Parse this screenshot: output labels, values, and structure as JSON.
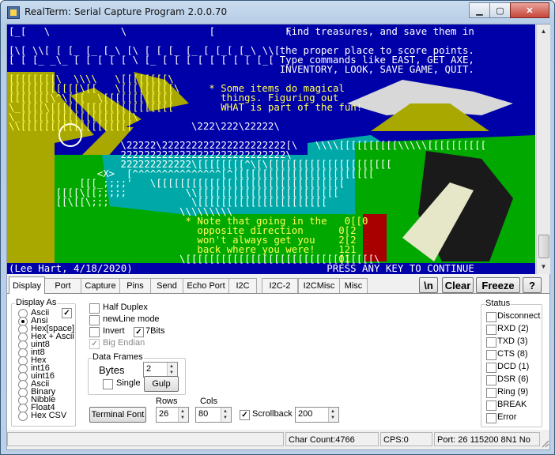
{
  "window": {
    "title": "RealTerm: Serial Capture Program 2.0.0.70"
  },
  "terminal": {
    "art": [
      {
        "t": "[_[   \\            \\              [            \\ ",
        "c": "w",
        "r": 0
      },
      {
        "t": "Find treasures, and save them in",
        "c": "w",
        "r": 0,
        "col": 47
      },
      {
        "t": "[\\[ \\\\[ [ [_ [_ [_\\ [\\ [ [ [_ [_ [ [_[ [_\\ \\\\[",
        "c": "w",
        "r": 2
      },
      {
        "t": "the proper place to score points.",
        "c": "w",
        "r": 2,
        "col": 46
      },
      {
        "t": "[ [ [_ _\\_ [ [ [ [ [ \\ [_ [ [ [ [ [ [ [ [ [_[",
        "c": "w",
        "r": 3
      },
      {
        "t": "Type commands like EAST, GET AXE,",
        "c": "w",
        "r": 3,
        "col": 46
      },
      {
        "t": "INVENTORY, LOOK, SAVE GAME, QUIT.",
        "c": "w",
        "r": 4,
        "col": 46
      },
      {
        "t": "[[[[[[[[\\  \\\\\\\\   \\[[[[[[[[\\",
        "c": "y",
        "r": 5
      },
      {
        "t": "[[[[[[[[[[[[\\[[   \\[[[[[[[[[\\ ",
        "c": "y",
        "r": 6
      },
      {
        "t": "* Some items do magical",
        "c": "y",
        "r": 6,
        "col": 34
      },
      {
        "t": "[[[[[[[\\^\\[[[  \\[[[[[[[[[[[[",
        "c": "y",
        "r": 7
      },
      {
        "t": "things. Figuring out",
        "c": "y",
        "r": 7,
        "col": 36
      },
      {
        "t": "WHAT is part of the fun!",
        "c": "y",
        "r": 8,
        "col": 36
      },
      {
        "t": "\\_[[[[\\[[[[[[[[[[[[[[[[[[[[[",
        "c": "y",
        "r": 8
      },
      {
        "t": "\\_[[[[[[[[[[[[[[[[[[[\\",
        "c": "y",
        "r": 9
      },
      {
        "t": "\\\\[[[[[[[[[[[[[[[[[[[",
        "c": "y",
        "r": 10
      },
      {
        "t": "\\222\\222\\22222\\",
        "c": "w",
        "r": 10,
        "col": 31
      },
      {
        "t": "\\22222\\222222222222222222222[\\   \\\\\\\\[[[[[[[[[[\\\\\\\\\\[[[[[[[[[[",
        "c": "w",
        "r": 12,
        "col": 19
      },
      {
        "t": "2222222222222222222222222222\\",
        "c": "w",
        "r": 13,
        "col": 19
      },
      {
        "t": "222222222222\\[[[[[[[[^\\[\\[[[[[[[[[[[[[[[[[[[[[",
        "c": "w",
        "r": 14,
        "col": 19
      },
      {
        "t": "<X>  [^^^^^^^^^^^^^^^[^[[[[[[[[[[[[[[[[[[[[[[[[",
        "c": "w",
        "r": 15,
        "col": 15
      },
      {
        "t": "[[[_;;;;'   \\[[[[[[[[[[[[[[[[[[[[[[[[[[[[[[[[",
        "c": "w",
        "r": 16,
        "col": 12
      },
      {
        "t": "[[[[\\[[;;;;;          \\\\[[[[[[[[[[[[[[[[[[[[[[[[",
        "c": "w",
        "r": 17,
        "col": 8
      },
      {
        "t": "[[\\[[\\;;;              \\[[[[[[[[[[[[[[[[[[[[[[",
        "c": "w",
        "r": 18,
        "col": 8
      },
      {
        "t": "\\\\\\\\\\\\\\\\\\",
        "c": "w",
        "r": 19,
        "col": 29
      },
      {
        "t": "* Note that going in the",
        "c": "y",
        "r": 20,
        "col": 30
      },
      {
        "t": "opposite direction",
        "c": "y",
        "r": 21,
        "col": 32
      },
      {
        "t": "won't always get you",
        "c": "y",
        "r": 22,
        "col": 32
      },
      {
        "t": "back where you were!",
        "c": "y",
        "r": 23,
        "col": 32
      },
      {
        "t": "0[[0",
        "c": "y",
        "r": 20,
        "col": 57
      },
      {
        "t": "0[2",
        "c": "y",
        "r": 21,
        "col": 56
      },
      {
        "t": "2[2",
        "c": "y",
        "r": 22,
        "col": 56
      },
      {
        "t": "121",
        "c": "y",
        "r": 23,
        "col": 56
      },
      {
        "t": "01",
        "c": "y",
        "r": 24,
        "col": 56
      },
      {
        "t": "\\[[[[[[[[[[[[[[[[[[[[[[[[[[[[[[[[\\",
        "c": "w",
        "r": 24,
        "col": 29
      },
      {
        "t": "(Lee Hart, 4/18/2020)",
        "c": "w",
        "r": 25,
        "col": 0
      },
      {
        "t": "PRESS ANY KEY TO CONTINUE",
        "c": "w",
        "r": 25,
        "col": 54
      }
    ]
  },
  "tabs": [
    "Display",
    "Port",
    "Capture",
    "Pins",
    "Send",
    "Echo Port",
    "I2C",
    "I2C-2",
    "I2CMisc",
    "Misc"
  ],
  "toolbar_buttons": {
    "newline": "\\n",
    "clear": "Clear",
    "freeze": "Freeze",
    "help": "?"
  },
  "display": {
    "display_as_label": "Display As",
    "formats": [
      "Ascii",
      "Ansi",
      "Hex[space]",
      "Hex + Ascii",
      "uint8",
      "int8",
      "Hex",
      "int16",
      "uint16",
      "Ascii",
      "Binary",
      "Nibble",
      "Float4",
      "Hex CSV"
    ],
    "selected_format": "Ansi",
    "half_duplex": "Half Duplex",
    "newline_mode": "newLine mode",
    "invert": "Invert",
    "bits7": "7Bits",
    "big_endian": "Big Endian",
    "data_frames_label": "Data Frames",
    "bytes_label": "Bytes",
    "bytes_value": "2",
    "single_label": "Single",
    "gulp_label": "Gulp",
    "terminal_font": "Terminal Font",
    "rows_label": "Rows",
    "rows_value": "26",
    "cols_label": "Cols",
    "cols_value": "80",
    "scrollback_label": "Scrollback",
    "scrollback_value": "200"
  },
  "status_group": {
    "label": "Status",
    "items": [
      "Disconnect",
      "RXD (2)",
      "TXD (3)",
      "CTS (8)",
      "DCD (1)",
      "DSR (6)",
      "Ring (9)",
      "BREAK",
      "Error"
    ]
  },
  "statusbar": {
    "char_count": "Char Count:4766",
    "cps": "CPS:0",
    "port": "Port: 26 115200 8N1 No"
  },
  "colors": {
    "terminal_bg": "#0000a8",
    "green": "#00a800",
    "cyan": "#00a8a8",
    "olive": "#a8a800",
    "yellow": "#ffff55",
    "white": "#ffffff",
    "red": "#a80000"
  }
}
